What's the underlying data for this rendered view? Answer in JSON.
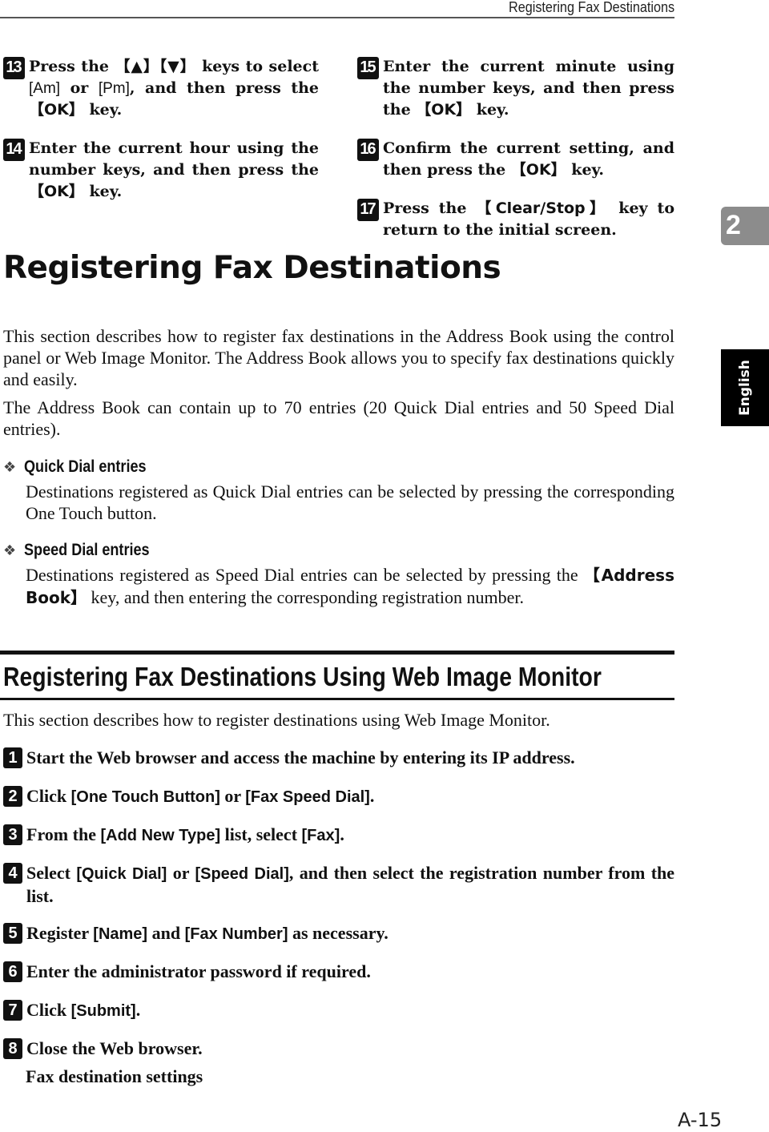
{
  "running_header": "Registering Fax Destinations",
  "side_tabs": {
    "chapter": "2",
    "language": "English"
  },
  "prev_steps": [
    {
      "num": "13",
      "parts": [
        "Press the ",
        "【▲】【▼】",
        " keys to select ",
        "[Am]",
        " or ",
        "[Pm]",
        ", and then press the ",
        "【OK】",
        " key."
      ]
    },
    {
      "num": "14",
      "parts": [
        "Enter the current hour using the number keys, and then press the ",
        "【OK】",
        " key."
      ]
    },
    {
      "num": "15",
      "parts": [
        "Enter the current minute using the number keys, and then press the ",
        "【OK】",
        " key."
      ]
    },
    {
      "num": "16",
      "parts": [
        "Confirm the current setting, and then press the ",
        "【OK】",
        " key."
      ]
    },
    {
      "num": "17",
      "parts": [
        "Press the ",
        "【Clear/Stop】",
        " key to return to the initial screen."
      ]
    }
  ],
  "section": {
    "title": "Registering Fax Destinations",
    "intro_1": "This section describes how to register fax destinations in the Address Book using the control panel or Web Image Monitor. The Address Book allows you to specify fax destinations quickly and easily.",
    "intro_2": "The Address Book can contain up to 70 entries (20 Quick Dial entries and 50 Speed Dial entries).",
    "notes": [
      {
        "icon": "❖",
        "title": "Quick Dial entries",
        "body": "Destinations registered as Quick Dial entries can be selected by pressing the corresponding One Touch button."
      },
      {
        "icon": "❖",
        "title": "Speed Dial entries",
        "body_key": "【Address Book】",
        "body_rest": " key, and then entering the corresponding registration number.",
        "body_prefix": "Destinations registered as Speed Dial entries can be selected by pressing the "
      }
    ]
  },
  "subsection": {
    "title": "Registering Fax Destinations Using Web Image Monitor",
    "intro": "This section describes how to register destinations using Web Image Monitor.",
    "steps": [
      {
        "num": "1",
        "parts": [
          "Start the Web browser and access the machine by entering its IP address."
        ]
      },
      {
        "num": "2",
        "parts": [
          "Click ",
          "[One Touch Button]",
          " or ",
          "[Fax Speed Dial]",
          "."
        ]
      },
      {
        "num": "3",
        "parts": [
          "From the ",
          "[Add New Type]",
          " list, select ",
          "[Fax]",
          "."
        ]
      },
      {
        "num": "4",
        "parts": [
          "Select ",
          "[Quick Dial]",
          " or ",
          "[Speed Dial]",
          ", and then select the registration number from the list."
        ]
      },
      {
        "num": "5",
        "parts": [
          "Register ",
          "[Name]",
          " and ",
          "[Fax Number]",
          " as necessary."
        ]
      },
      {
        "num": "6",
        "parts": [
          "Enter the administrator password if required."
        ]
      },
      {
        "num": "7",
        "parts": [
          "Click ",
          "[Submit]",
          "."
        ]
      },
      {
        "num": "8",
        "parts": [
          "Close the Web browser."
        ]
      }
    ],
    "result": "Fax destination settings"
  },
  "page_number": "A-15"
}
